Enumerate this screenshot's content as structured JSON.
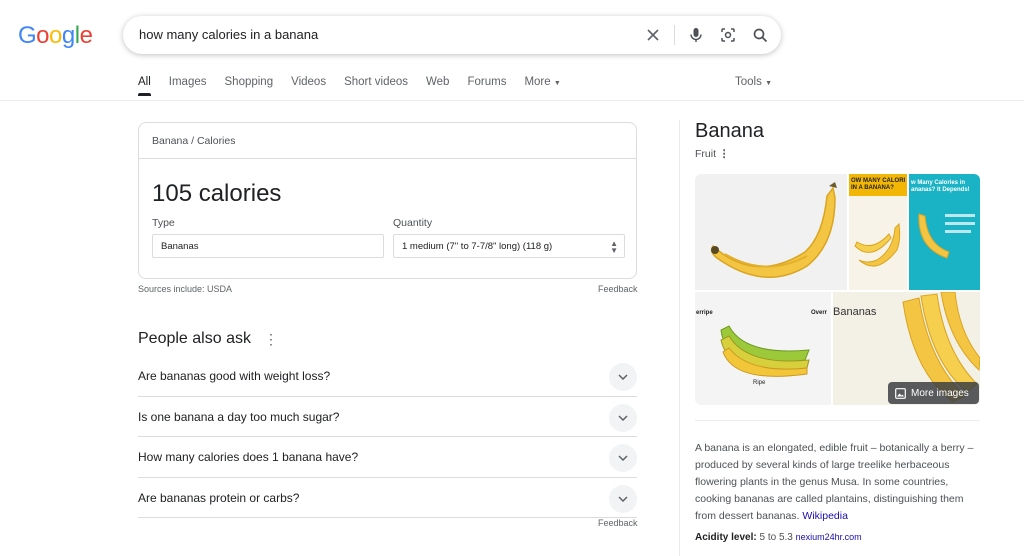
{
  "logo": {
    "letters": [
      "G",
      "o",
      "o",
      "g",
      "l",
      "e"
    ],
    "colors": [
      "#4285F4",
      "#EA4335",
      "#FBBC05",
      "#4285F4",
      "#34A853",
      "#EA4335"
    ]
  },
  "search": {
    "query": "how many calories in a banana"
  },
  "tabs": [
    {
      "label": "All",
      "active": true
    },
    {
      "label": "Images"
    },
    {
      "label": "Shopping"
    },
    {
      "label": "Videos"
    },
    {
      "label": "Short videos"
    },
    {
      "label": "Web"
    },
    {
      "label": "Forums"
    },
    {
      "label": "More"
    }
  ],
  "tools_label": "Tools",
  "calorie_card": {
    "breadcrumb_food": "Banana",
    "breadcrumb_sep": "/",
    "breadcrumb_metric": "Calories",
    "value": "105 calories",
    "type_label": "Type",
    "type_value": "Bananas",
    "quantity_label": "Quantity",
    "quantity_value": "1 medium (7\" to 7-7/8\" long) (118 g)",
    "sources": "Sources include: USDA",
    "feedback": "Feedback"
  },
  "people_also_ask": {
    "title": "People also ask",
    "questions": [
      "Are bananas good with weight loss?",
      "Is one banana a day too much sugar?",
      "How many calories does 1 banana have?",
      "Are bananas protein or carbs?"
    ],
    "feedback": "Feedback"
  },
  "knowledge_panel": {
    "title": "Banana",
    "subtitle": "Fruit",
    "more_images": "More images",
    "image_texts": {
      "img2": "OW MANY CALORI IN A BANANA?",
      "img3": "w Many Calories in ananas? It Depends!",
      "img4_left": "erripe",
      "img4_right": "Overr",
      "img4_bottom": "Ripe",
      "img5": "Bananas"
    },
    "description": "A banana is an elongated, edible fruit – botanically a berry – produced by several kinds of large treelike herbaceous flowering plants in the genus Musa. In some countries, cooking bananas are called plantains, distinguishing them from dessert bananas.",
    "wiki_link": "Wikipedia",
    "acidity_label": "Acidity level:",
    "acidity_value": "5 to 5.3",
    "acidity_source": "nexium24hr.com"
  },
  "colors": {
    "link": "#1a0dab",
    "text": "#202124",
    "muted": "#4d5156"
  }
}
